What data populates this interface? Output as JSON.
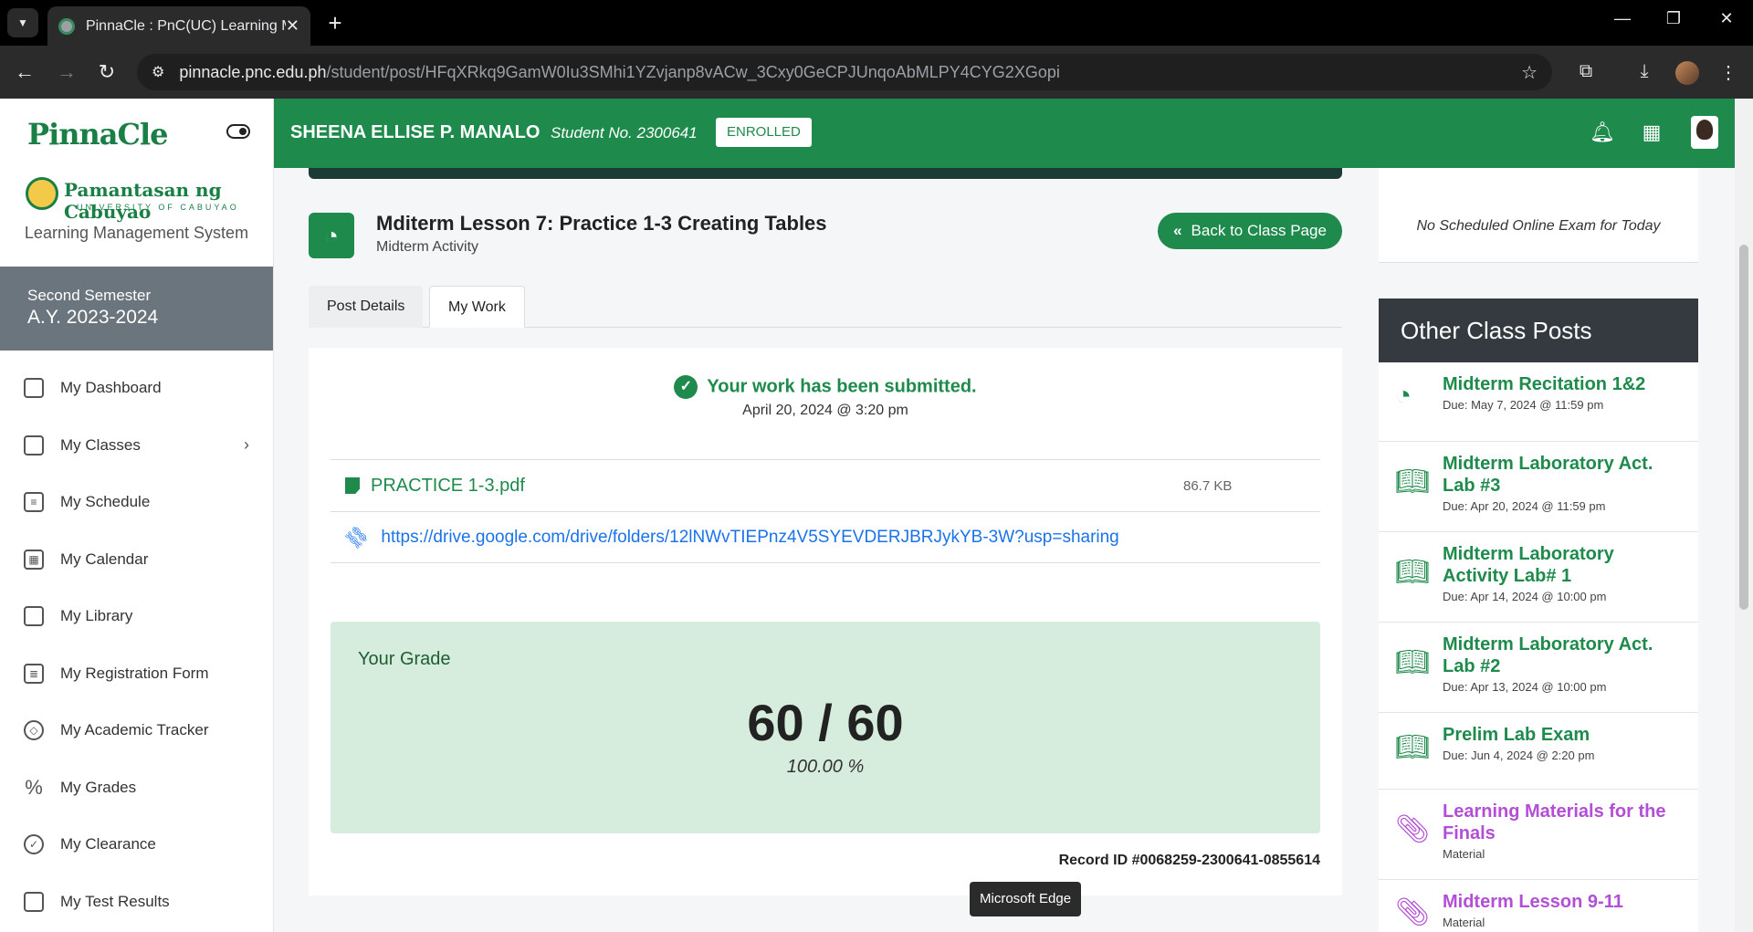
{
  "browser": {
    "tab_title": "PinnaCle : PnC(UC) Learning Ma",
    "url_host": "pinnacle.pnc.edu.ph",
    "url_path": "/student/post/HFqXRkq9GamW0Iu3SMhi1YZvjanp8vACw_3Cxy0GeCPJUnqoAbMLPY4CYG2XGopi"
  },
  "sidebar": {
    "logo": "PinnaCle",
    "university": "Pamantasan ng Cabuyao",
    "university_sub": "UNIVERSITY OF CABUYAO",
    "lms_label": "Learning Management System",
    "semester": "Second Semester",
    "academic_year": "A.Y. 2023-2024",
    "items": [
      {
        "label": "My Dashboard",
        "icon": "dashboard-icon"
      },
      {
        "label": "My Classes",
        "icon": "cast-icon"
      },
      {
        "label": "My Schedule",
        "icon": "schedule-icon"
      },
      {
        "label": "My Calendar",
        "icon": "calendar-icon"
      },
      {
        "label": "My Library",
        "icon": "book-icon"
      },
      {
        "label": "My Registration Form",
        "icon": "document-icon"
      },
      {
        "label": "My Academic Tracker",
        "icon": "compass-icon"
      },
      {
        "label": "My Grades",
        "icon": "percent-icon"
      },
      {
        "label": "My Clearance",
        "icon": "check-circle-icon"
      },
      {
        "label": "My Test Results",
        "icon": "clipboard-icon"
      }
    ]
  },
  "topbar": {
    "student_name": "SHEENA ELLISE P. MANALO",
    "student_no": "Student No. 2300641",
    "status": "ENROLLED"
  },
  "post": {
    "title": "Mditerm Lesson 7: Practice 1-3 Creating Tables",
    "subtitle": "Midterm Activity",
    "back_label": "Back to Class Page",
    "tabs": [
      "Post Details",
      "My Work"
    ]
  },
  "work": {
    "submitted_msg": "Your work has been submitted.",
    "submitted_date": "April 20, 2024 @ 3:20 pm",
    "file_name": "PRACTICE 1-3.pdf",
    "file_size": "86.7 KB",
    "link_url": "https://drive.google.com/drive/folders/12lNWvTIEPnz4V5SYEVDERJBRJykYB-3W?usp=sharing",
    "grade_label": "Your Grade",
    "grade_score": "60 / 60",
    "grade_percent": "100.00 %",
    "record_id": "Record ID #0068259-2300641-0855614"
  },
  "tooltip": "Microsoft Edge",
  "exam": {
    "message": "No Scheduled Online Exam for Today"
  },
  "other_posts": {
    "heading": "Other Class Posts",
    "items": [
      {
        "title": "Midterm Recitation 1&2",
        "due": "Due: May 7, 2024 @ 11:59 pm",
        "icon": "pie-chart-icon"
      },
      {
        "title": "Midterm Laboratory Act. Lab #3",
        "due": "Due: Apr 20, 2024 @ 11:59 pm",
        "icon": "open-book-icon"
      },
      {
        "title": "Midterm Laboratory Activity Lab# 1",
        "due": "Due: Apr 14, 2024 @ 10:00 pm",
        "icon": "open-book-icon"
      },
      {
        "title": "Midterm Laboratory Act. Lab #2",
        "due": "Due: Apr 13, 2024 @ 10:00 pm",
        "icon": "open-book-icon"
      },
      {
        "title": "Prelim Lab Exam",
        "due": "Due: Jun 4, 2024 @ 2:20 pm",
        "icon": "open-book-icon"
      },
      {
        "title": "Learning Materials for the Finals",
        "due": "Material",
        "icon": "paperclip-icon"
      },
      {
        "title": "Midterm Lesson 9-11",
        "due": "Material",
        "icon": "paperclip-icon"
      }
    ]
  },
  "colors": {
    "brand_green": "#1e8a4c",
    "material_purple": "#b24fd6",
    "grade_bg": "#d6ecdc"
  }
}
